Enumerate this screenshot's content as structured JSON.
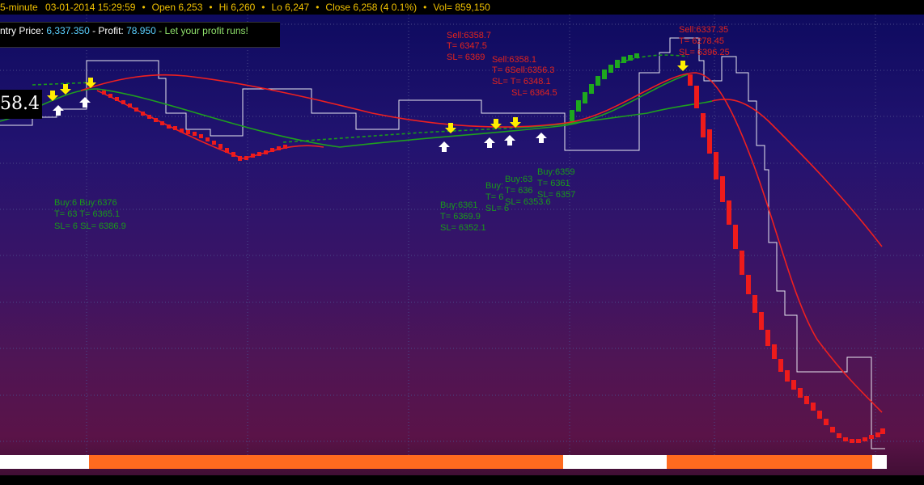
{
  "header": {
    "interval": "5-minute",
    "datetime": "03-01-2014 15:29:59",
    "open": "Open 6,253",
    "hi": "Hi 6,260",
    "lo": "Lo 6,247",
    "close": "Close 6,258 (4 0.1%)",
    "vol": "Vol= 859,150"
  },
  "entry": {
    "prefix": "ntry Price: ",
    "price": "6,337.350",
    "profit_label": " - Profit: ",
    "profit": "78.950",
    "message": " - Let your profit runs!"
  },
  "price_tag": "58.4",
  "annotations": {
    "sell1": [
      "Sell:6358.7",
      "T= 6347.5",
      "SL= 6369"
    ],
    "sell2": [
      "Sell:6358.1",
      "T= 6Sell:6356.3",
      "SL= T= 6348.1",
      "SL= 6364.5"
    ],
    "sell3": [
      "Sell:6337.35",
      "T= 6278.45",
      "SL= 6396.25"
    ],
    "buy1": [
      "Buy:6 Buy:6376",
      "T= 63 T= 6365.1",
      "SL= 6 SL= 6386.9"
    ],
    "buy2": [
      "Buy:6361",
      "T= 6369.9",
      "SL= 6352.1"
    ],
    "buy3": [
      "Buy:",
      "T= 6",
      "SL= 6"
    ],
    "buy4": [
      "Buy:63",
      "T= 636",
      "SL= 6353.6"
    ],
    "buy5": [
      "Buy:6359",
      "T= 6361",
      "SL= 6357"
    ]
  },
  "colors": {
    "sell": "#e3241d",
    "buy": "#1a9a1a",
    "buy_arrow": "#ffffff",
    "sell_arrow": "#ffff00",
    "bar_orange": "#ff6a1f",
    "bar_white": "#ffffff"
  },
  "bottom_bar": [
    {
      "color": "white",
      "start": 0,
      "end": 0.1
    },
    {
      "color": "orange",
      "start": 0.1,
      "end": 0.635
    },
    {
      "color": "white",
      "start": 0.635,
      "end": 0.752
    },
    {
      "color": "orange",
      "start": 0.752,
      "end": 0.984
    },
    {
      "color": "white",
      "start": 0.984,
      "end": 1
    }
  ]
}
